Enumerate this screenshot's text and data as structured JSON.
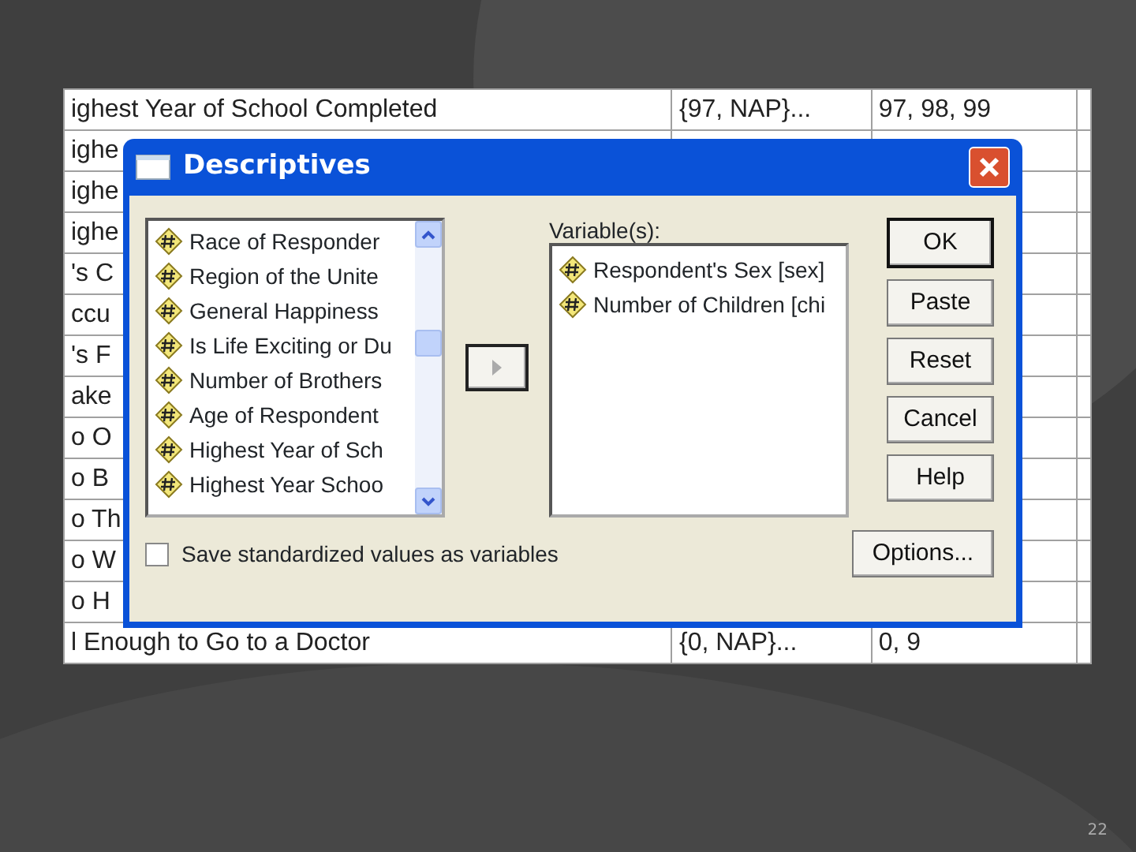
{
  "background_table": {
    "rows": [
      {
        "cells": [
          "ighest Year of School Completed",
          "{97, NAP}...",
          "97, 98, 99"
        ]
      },
      {
        "cells": [
          "ighe",
          "",
          ""
        ]
      },
      {
        "cells": [
          "ighe",
          "",
          ""
        ]
      },
      {
        "cells": [
          "ighe",
          "",
          ""
        ]
      },
      {
        "cells": [
          "'s C",
          "",
          ""
        ]
      },
      {
        "cells": [
          "ccu",
          "",
          ""
        ]
      },
      {
        "cells": [
          "'s F",
          "",
          ""
        ]
      },
      {
        "cells": [
          "ake",
          "",
          ""
        ]
      },
      {
        "cells": [
          "o O",
          "",
          ""
        ]
      },
      {
        "cells": [
          "o B",
          "",
          ""
        ]
      },
      {
        "cells": [
          "o Th",
          "",
          ""
        ]
      },
      {
        "cells": [
          "o W",
          "",
          ""
        ]
      },
      {
        "cells": [
          "o H",
          "",
          ""
        ]
      },
      {
        "cells": [
          "l Enough to Go to a Doctor",
          "{0, NAP}...",
          "0, 9"
        ]
      }
    ]
  },
  "dialog": {
    "title": "Descriptives",
    "source_list": {
      "items": [
        {
          "label": "Race of Responder",
          "selected": false
        },
        {
          "label": "Region of the Unite",
          "selected": false
        },
        {
          "label": "General Happiness",
          "selected": false
        },
        {
          "label": "Is Life Exciting or Du",
          "selected": false
        },
        {
          "label": "Number of Brothers",
          "selected": false
        },
        {
          "label": "Age of Respondent",
          "selected": false
        },
        {
          "label": "Highest Year of Sch",
          "selected": false
        },
        {
          "label": "Highest Year Schoo",
          "selected": false
        }
      ]
    },
    "move_button": {
      "disabled": true
    },
    "variables_label": "Variable(s):",
    "variables_list": {
      "items": [
        {
          "label": "Respondent's Sex [sex]",
          "selected": false
        },
        {
          "label": "Number of Children [chi",
          "selected": false
        }
      ]
    },
    "buttons": [
      {
        "label": "OK",
        "default": true
      },
      {
        "label": "Paste",
        "default": false
      },
      {
        "label": "Reset",
        "default": false
      },
      {
        "label": "Cancel",
        "default": false
      },
      {
        "label": "Help",
        "default": false
      }
    ],
    "checkbox": {
      "label": "Save standardized values as variables",
      "checked": false
    },
    "options_button": "Options..."
  },
  "slide_number": "22"
}
